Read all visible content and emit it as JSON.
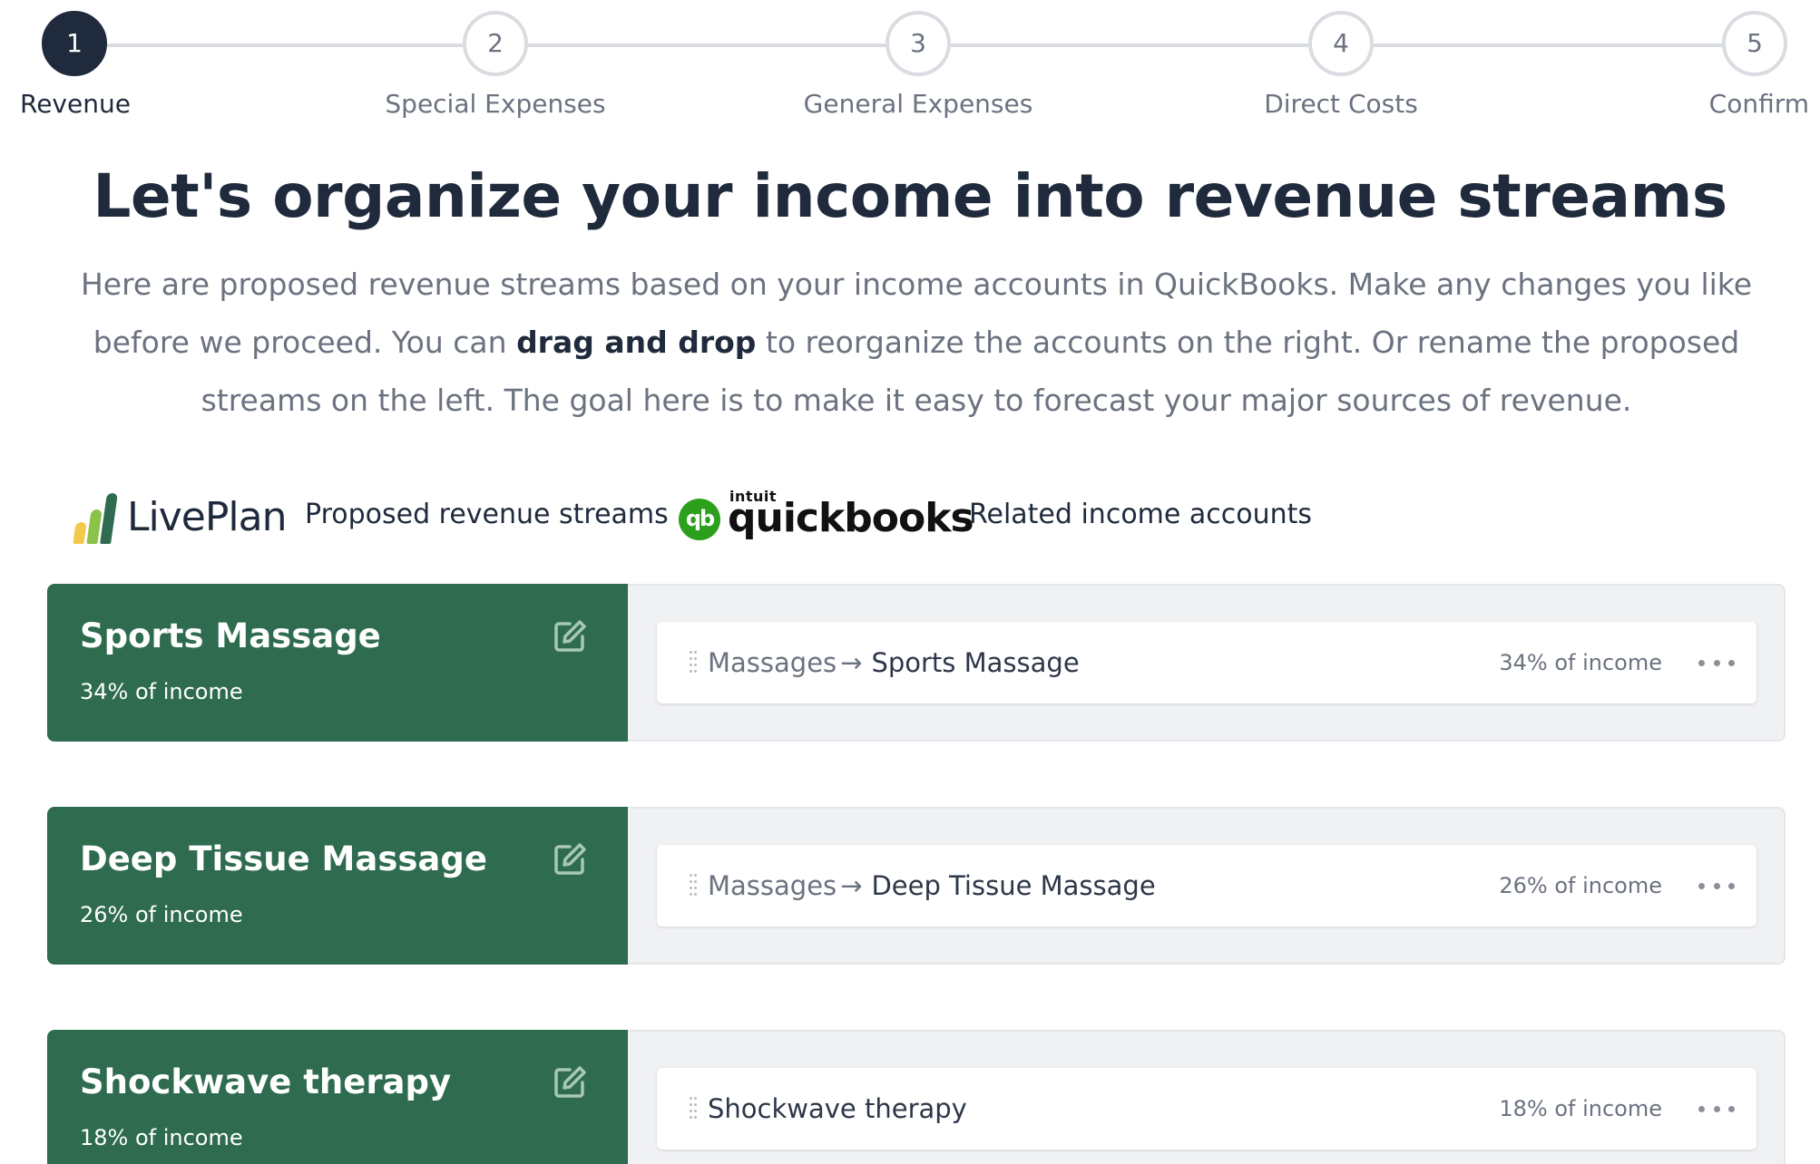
{
  "stepper": {
    "steps": [
      {
        "number": "1",
        "label": "Revenue",
        "active": true
      },
      {
        "number": "2",
        "label": "Special Expenses",
        "active": false
      },
      {
        "number": "3",
        "label": "General Expenses",
        "active": false
      },
      {
        "number": "4",
        "label": "Direct Costs",
        "active": false
      },
      {
        "number": "5",
        "label": "Confirm",
        "active": false
      }
    ]
  },
  "page": {
    "title": "Let's organize your income into revenue streams",
    "intro_before": "Here are proposed revenue streams based on your income accounts in QuickBooks. Make any changes you like before we proceed. You can ",
    "intro_bold": "drag and drop",
    "intro_after": " to reorganize the accounts on the right. Or rename the proposed streams on the left. The goal here is to make it easy to forecast your major sources of revenue."
  },
  "columns": {
    "liveplan_logo_text": "LivePlan",
    "proposed_label": "Proposed revenue streams",
    "qb_logo_small": "intuit",
    "qb_logo_text": "quickbooks",
    "qb_circle_text": "qb",
    "related_label": "Related income accounts"
  },
  "streams": [
    {
      "name": "Sports Massage",
      "pct": "34% of income",
      "account": {
        "parent": "Massages",
        "arrow": "→",
        "name": "Sports Massage",
        "pct": "34% of income"
      }
    },
    {
      "name": "Deep Tissue Massage",
      "pct": "26% of income",
      "account": {
        "parent": "Massages",
        "arrow": "→",
        "name": "Deep Tissue Massage",
        "pct": "26% of income"
      }
    },
    {
      "name": "Shockwave therapy",
      "pct": "18% of income",
      "account": {
        "parent": "",
        "arrow": "",
        "name": "Shockwave therapy",
        "pct": "18% of income"
      }
    }
  ],
  "icons": {
    "edit": "edit-icon",
    "more": "more-options-icon",
    "drag": "drag-handle-icon"
  },
  "colors": {
    "stream_green": "#2e6b4f",
    "navy": "#1f2a3c",
    "muted_text": "#6b7280",
    "panel_bg": "#f0f1f3",
    "quickbooks_green": "#2ca01c",
    "liveplan_bar_yellow": "#f2c94c",
    "liveplan_bar_lightgreen": "#8bc34a",
    "liveplan_bar_green": "#2e6b4f"
  }
}
